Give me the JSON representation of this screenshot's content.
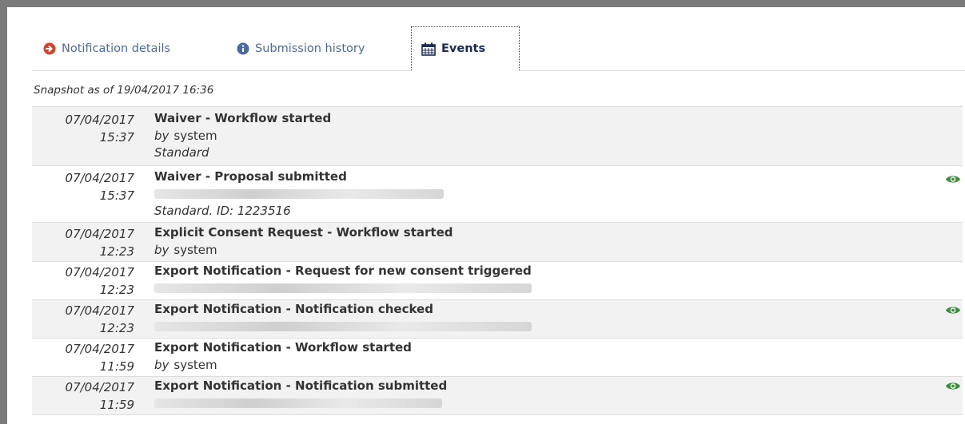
{
  "tabs": [
    {
      "label": "Notification details",
      "icon": "arrow-circle-right-icon",
      "color": "#d9402b"
    },
    {
      "label": "Submission history",
      "icon": "info-circle-icon",
      "color": "#4a6aa5"
    },
    {
      "label": "Events",
      "icon": "calendar-icon",
      "selected": true
    }
  ],
  "snapshot": "Snapshot as of 19/04/2017 16:36",
  "by_label": "by",
  "events": [
    {
      "date": "07/04/2017",
      "time": "15:37",
      "title": "Waiver - Workflow started",
      "by": "system",
      "extra": "Standard",
      "eye": false
    },
    {
      "date": "07/04/2017",
      "time": "15:37",
      "title": "Waiver - Proposal submitted",
      "redacted": true,
      "extra": "Standard. ID: 1223516",
      "eye": true
    },
    {
      "date": "07/04/2017",
      "time": "12:23",
      "title": "Explicit Consent Request - Workflow started",
      "by": "system",
      "eye": false
    },
    {
      "date": "07/04/2017",
      "time": "12:23",
      "title": "Export Notification - Request for new consent triggered",
      "redacted": true,
      "eye": false
    },
    {
      "date": "07/04/2017",
      "time": "12:23",
      "title": "Export Notification - Notification checked",
      "redacted": true,
      "eye": true
    },
    {
      "date": "07/04/2017",
      "time": "11:59",
      "title": "Export Notification - Workflow started",
      "by": "system",
      "eye": false
    },
    {
      "date": "07/04/2017",
      "time": "11:59",
      "title": "Export Notification - Notification submitted",
      "redacted": true,
      "eye": true
    }
  ],
  "colors": {
    "eye": "#3a8f3a",
    "tab_link": "#4a6aa5",
    "active_tab": "#1c2a5a"
  }
}
